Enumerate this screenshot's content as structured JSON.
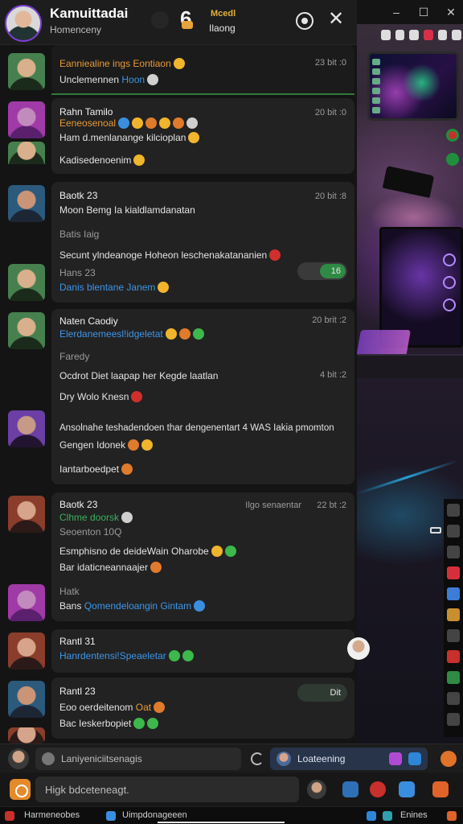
{
  "window": {
    "title": "Kamuittadai",
    "subtitle": "Homenceny"
  },
  "header": {
    "badge_digit": "6",
    "label_top": "Mcedl",
    "label_bottom": "Ilaong",
    "close_glyph": "✕"
  },
  "messages": [
    {
      "line1": "Eanniealine ings Eontiaon",
      "line2_plain": "Unclemennen",
      "line2_link": "Hoon",
      "time": "23 bit :0"
    },
    {
      "name": "Rahn Tamilo",
      "role": "Eeneosenoal",
      "line2": "Ham d.menlanange kilcioplan",
      "line3": "Kadisedenoenim",
      "time": "20 bit :0"
    },
    {
      "name": "Baotk 23",
      "line2": "Moon Bemg Ia kialdlamdanatan",
      "line3": "Batis Iaig",
      "line4": "Secunt ylndeanoge Hoheon leschenakatananien",
      "line5_name": "Hans 23",
      "line5_link": "Danis blentane Janem",
      "time": "20 bit :8",
      "pill_label": "16"
    },
    {
      "name": "Naten Caodiy",
      "role": "Elerdanemeesl!idgeletat",
      "line3": "Faredy",
      "line4": "Ocdrot Diet laapap her Kegde laatlan",
      "line5": "Dry Wolo Knesn",
      "line6": "Ansolnahe teshadendoen thar dengenentart 4 WAS Iakia pmomton",
      "line7": "Gengen Idonek",
      "line8": "Iantarboedpet",
      "time": "20 brit :2",
      "time2": "4 bit :2"
    },
    {
      "name": "Baotk 23",
      "role": "Clhme doorsk",
      "right_note": "Ilgo senaentar",
      "line3": "Seoenton 10Q",
      "line4": "Esmphisno de deideWain Oharobe",
      "line5": "Bar idaticneannaajer",
      "line6": "Hatk",
      "line7_name": "Bans",
      "line7_link": "Qomendeloangin Gintam",
      "time": "22 bt :2"
    },
    {
      "name": "Rantl 31",
      "role": "Hanrdentensi!Speaeletar"
    },
    {
      "name": "Rantl 23",
      "line2": "Eoo oerdeitenom",
      "line2_accent": "Oat",
      "line3": "Bac Ieskerbopiet",
      "pill_label": "Dit"
    }
  ],
  "reply_bar": {
    "placeholder": "Laniyeniciitsenagis",
    "listening": "Loateening"
  },
  "composer": {
    "placeholder": "Higk bdceteneagt."
  },
  "taskbar": {
    "item1": "Harmeneobes",
    "item2": "Uimpdonageeen",
    "item3": "Enines"
  },
  "colors": {
    "accent_orange": "#e89a37",
    "link_blue": "#3e96e8",
    "online_green": "#39b25a",
    "panel": "#222222"
  },
  "icons": [
    "close-icon",
    "target-icon",
    "minimize-icon",
    "maximize-icon",
    "plus-icon",
    "emoji-icon",
    "spinner-icon"
  ]
}
